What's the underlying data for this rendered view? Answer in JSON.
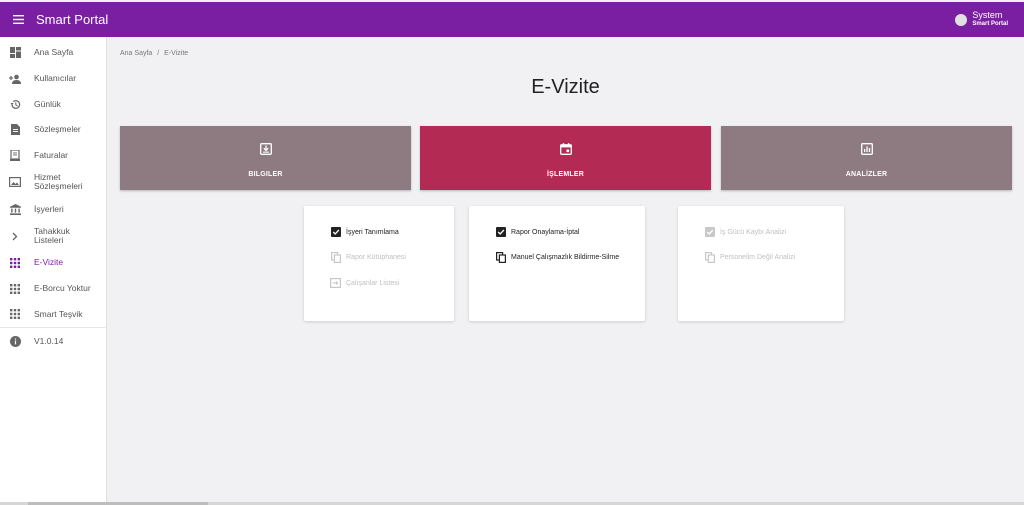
{
  "app": {
    "title": "Smart Portal"
  },
  "user": {
    "name": "System",
    "subtitle": "Smart Portal"
  },
  "sidebar": {
    "items": [
      {
        "label": "Ana Sayfa",
        "icon": "dashboard-icon"
      },
      {
        "label": "Kullanıcılar",
        "icon": "person-add-icon"
      },
      {
        "label": "Günlük",
        "icon": "history-icon"
      },
      {
        "label": "Sözleşmeler",
        "icon": "document-icon"
      },
      {
        "label": "Faturalar",
        "icon": "receipt-icon"
      },
      {
        "label": "Hizmet Sözleşmeleri",
        "icon": "picture-icon"
      },
      {
        "label": "İşyerleri",
        "icon": "bank-icon"
      },
      {
        "label": "Tahakkuk Listeleri",
        "icon": "chevron-right-icon"
      },
      {
        "label": "E-Vizite",
        "icon": "apps-icon",
        "active": true
      },
      {
        "label": "E-Borcu Yoktur",
        "icon": "apps-icon"
      },
      {
        "label": "Smart Teşvik",
        "icon": "apps-icon"
      },
      {
        "label": "V1.0.14",
        "icon": "info-icon"
      }
    ]
  },
  "breadcrumb": {
    "home": "Ana Sayfa",
    "separator": "/",
    "current": "E-Vizite"
  },
  "page": {
    "title": "E-Vizite"
  },
  "tabs": {
    "bilgiler": "BILGILER",
    "islemler": "İŞLEMLER",
    "analizler": "ANALİZLER"
  },
  "cards": {
    "card1": [
      {
        "label": "İşyeri Tanımlama",
        "icon": "checkbox-icon",
        "disabled": false
      },
      {
        "label": "Rapor Kütüphanesi",
        "icon": "copy-icon",
        "disabled": true
      },
      {
        "label": "Çalışanlar Listesi",
        "icon": "input-icon",
        "disabled": true
      }
    ],
    "card2": [
      {
        "label": "Rapor Onaylama-İptal",
        "icon": "checkbox-icon",
        "disabled": false
      },
      {
        "label": "Manuel Çalışmazlık Bildirme-Silme",
        "icon": "copy-icon",
        "disabled": false
      }
    ],
    "card3": [
      {
        "label": "İş Gücü Kaybı Analizi",
        "icon": "checkbox-icon",
        "disabled": true
      },
      {
        "label": "Personelim Değil Analizi",
        "icon": "copy-icon",
        "disabled": true
      }
    ]
  },
  "colors": {
    "primary": "#7b1fa2",
    "tab_active": "#b32b55",
    "tab_inactive": "#8e7b82"
  }
}
